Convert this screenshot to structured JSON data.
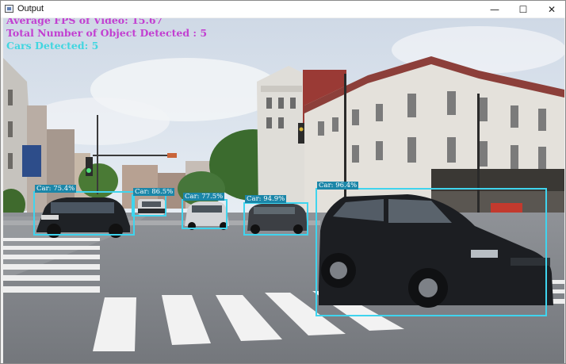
{
  "window": {
    "title": "Output",
    "minimize_glyph": "—",
    "maximize_glyph": "☐",
    "close_glyph": "✕"
  },
  "overlay": {
    "fps_text": "Average FPS of Video: 15.67",
    "total_text": "Total Number of Object Detected : 5",
    "cars_text": "Cars Detected: 5",
    "fps_color": "#c23fd1",
    "total_color": "#c23fd1",
    "cars_color": "#41d6e0"
  },
  "detections": [
    {
      "label": "Car: 75.4%"
    },
    {
      "label": "Car: 86.5%"
    },
    {
      "label": "Car: 77.5%"
    },
    {
      "label": "Car: 94.9%"
    },
    {
      "label": "Car: 96.4%"
    }
  ],
  "colors": {
    "box": "#3fd4ee"
  }
}
